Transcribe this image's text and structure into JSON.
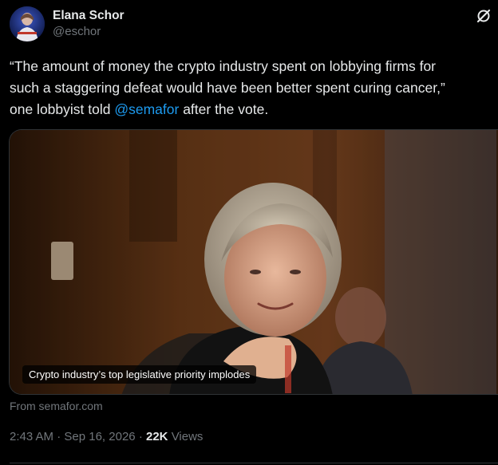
{
  "author": {
    "name": "Elana Schor",
    "handle": "@eschor"
  },
  "tweet": {
    "text_before": "“The amount of money the crypto industry spent on lobbying firms for\nsuch a staggering defeat would have been better spent curing cancer,”\none lobbyist told ",
    "mention": "@semafor",
    "text_after": " after the vote."
  },
  "card": {
    "headline": "Crypto industry’s top legislative priority implodes",
    "source": "From semafor.com"
  },
  "meta": {
    "time": "2:43 AM",
    "separator": "·",
    "date": "Sep 16, 2026",
    "views_count": "22K",
    "views_label": "Views"
  },
  "icons": {
    "grok": "grok-icon"
  },
  "colors": {
    "background": "#000000",
    "text": "#e7e9ea",
    "muted": "#71767b",
    "link": "#1d9bf0",
    "border": "#2f3336"
  }
}
